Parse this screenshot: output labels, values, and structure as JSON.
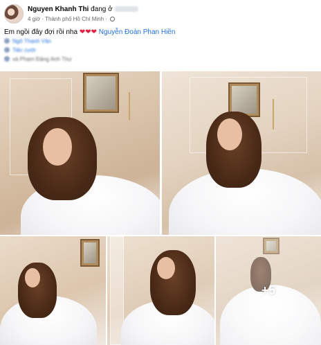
{
  "post": {
    "author": {
      "name": "Nguyen Khanh Thi",
      "status_prefix": "đang ở"
    },
    "meta": {
      "time": "4 giờ",
      "separator": "·",
      "location": "Thành phố Hồ Chí Minh",
      "privacy_icon": "globe-icon"
    },
    "caption": {
      "text": "Em ngồi đây đợi rồi nha",
      "hearts": [
        "❤",
        "❤",
        "❤"
      ],
      "tagged": "Nguyễn Đoàn Phan Hiền"
    },
    "blurred_lines": [
      "Ngô Thanh Vân",
      "Tiệc cưới",
      "và Phạm Đặng Anh Thư"
    ],
    "photos": {
      "more_count": "+5"
    },
    "colors": {
      "link": "#216fdb",
      "heart": "#e41e3f",
      "meta": "#65676b"
    }
  }
}
